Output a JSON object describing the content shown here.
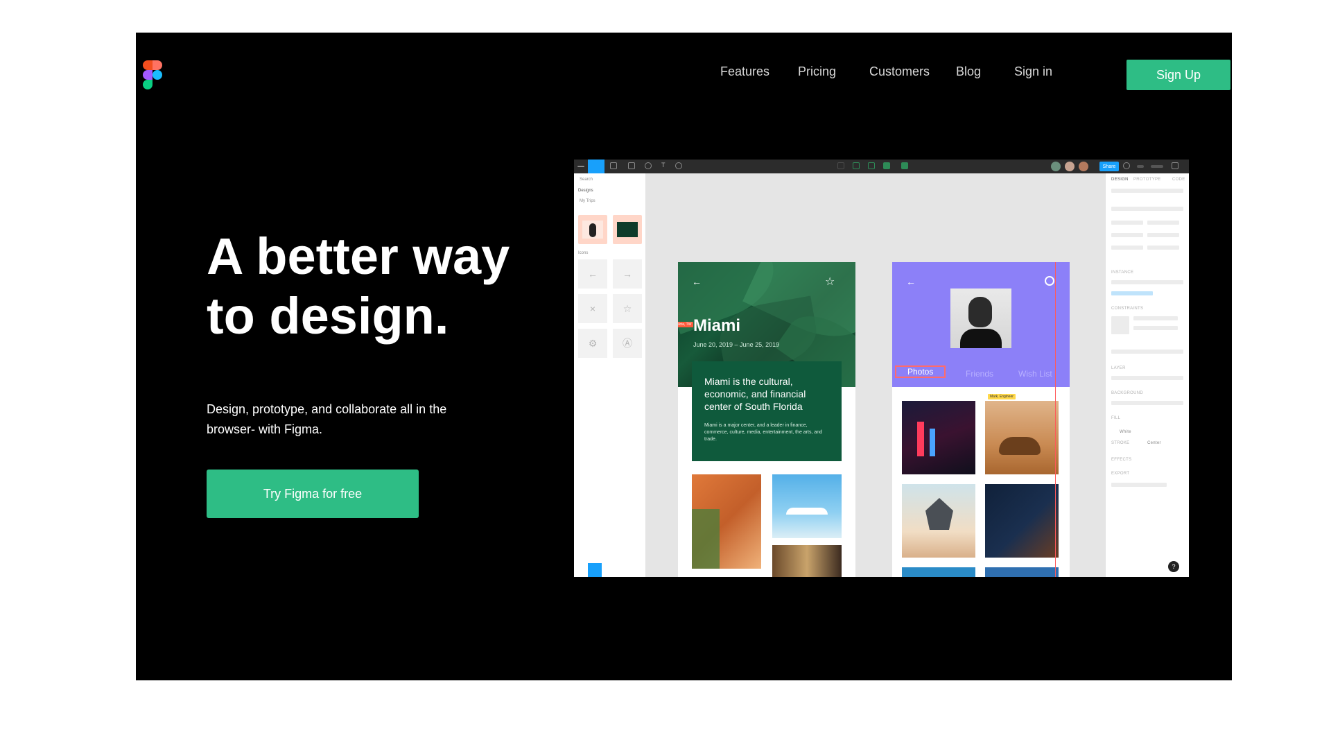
{
  "nav": {
    "links": [
      "Features",
      "Pricing",
      "Customers",
      "Blog",
      "Sign in"
    ],
    "signup": "Sign Up"
  },
  "hero": {
    "headline_line1": "A better way",
    "headline_line2": "to design.",
    "subhead": "Design, prototype, and collaborate all in the browser- with Figma.",
    "cta": "Try Figma for free"
  },
  "mock": {
    "toolbar_share": "Share",
    "left_panel": {
      "search": "Search",
      "pages": "Designs",
      "section": "My Trips",
      "icons_label": "Icons"
    },
    "miami": {
      "title": "Miami",
      "dates": "June 20, 2019 – June 25, 2019",
      "card_heading": "Miami is the cultural, economic, and financial center of South Florida",
      "card_body": "Miami is a major center, and a leader in finance, commerce, culture, media, entertainment, the arts, and trade.",
      "badge": "Alicia, TW"
    },
    "profile": {
      "tabs": [
        "Photos",
        "Friends",
        "Wish List"
      ],
      "badge": "Mark, Engineer"
    },
    "right_panel": {
      "tabs": [
        "DESIGN",
        "PROTOTYPE",
        "CODE"
      ],
      "sections": [
        "INSTANCE",
        "CONSTRAINTS",
        "LAYER",
        "BACKGROUND",
        "FILL",
        "STROKE",
        "EFFECTS",
        "EXPORT"
      ],
      "fill_value": "White",
      "stroke_value": "Center"
    },
    "help": "?"
  },
  "colors": {
    "accent": "#2ebd85",
    "background": "#000000",
    "figma_blue": "#18a0fb",
    "profile_purple": "#8c80f8",
    "miami_green": "#0f5a3c"
  }
}
